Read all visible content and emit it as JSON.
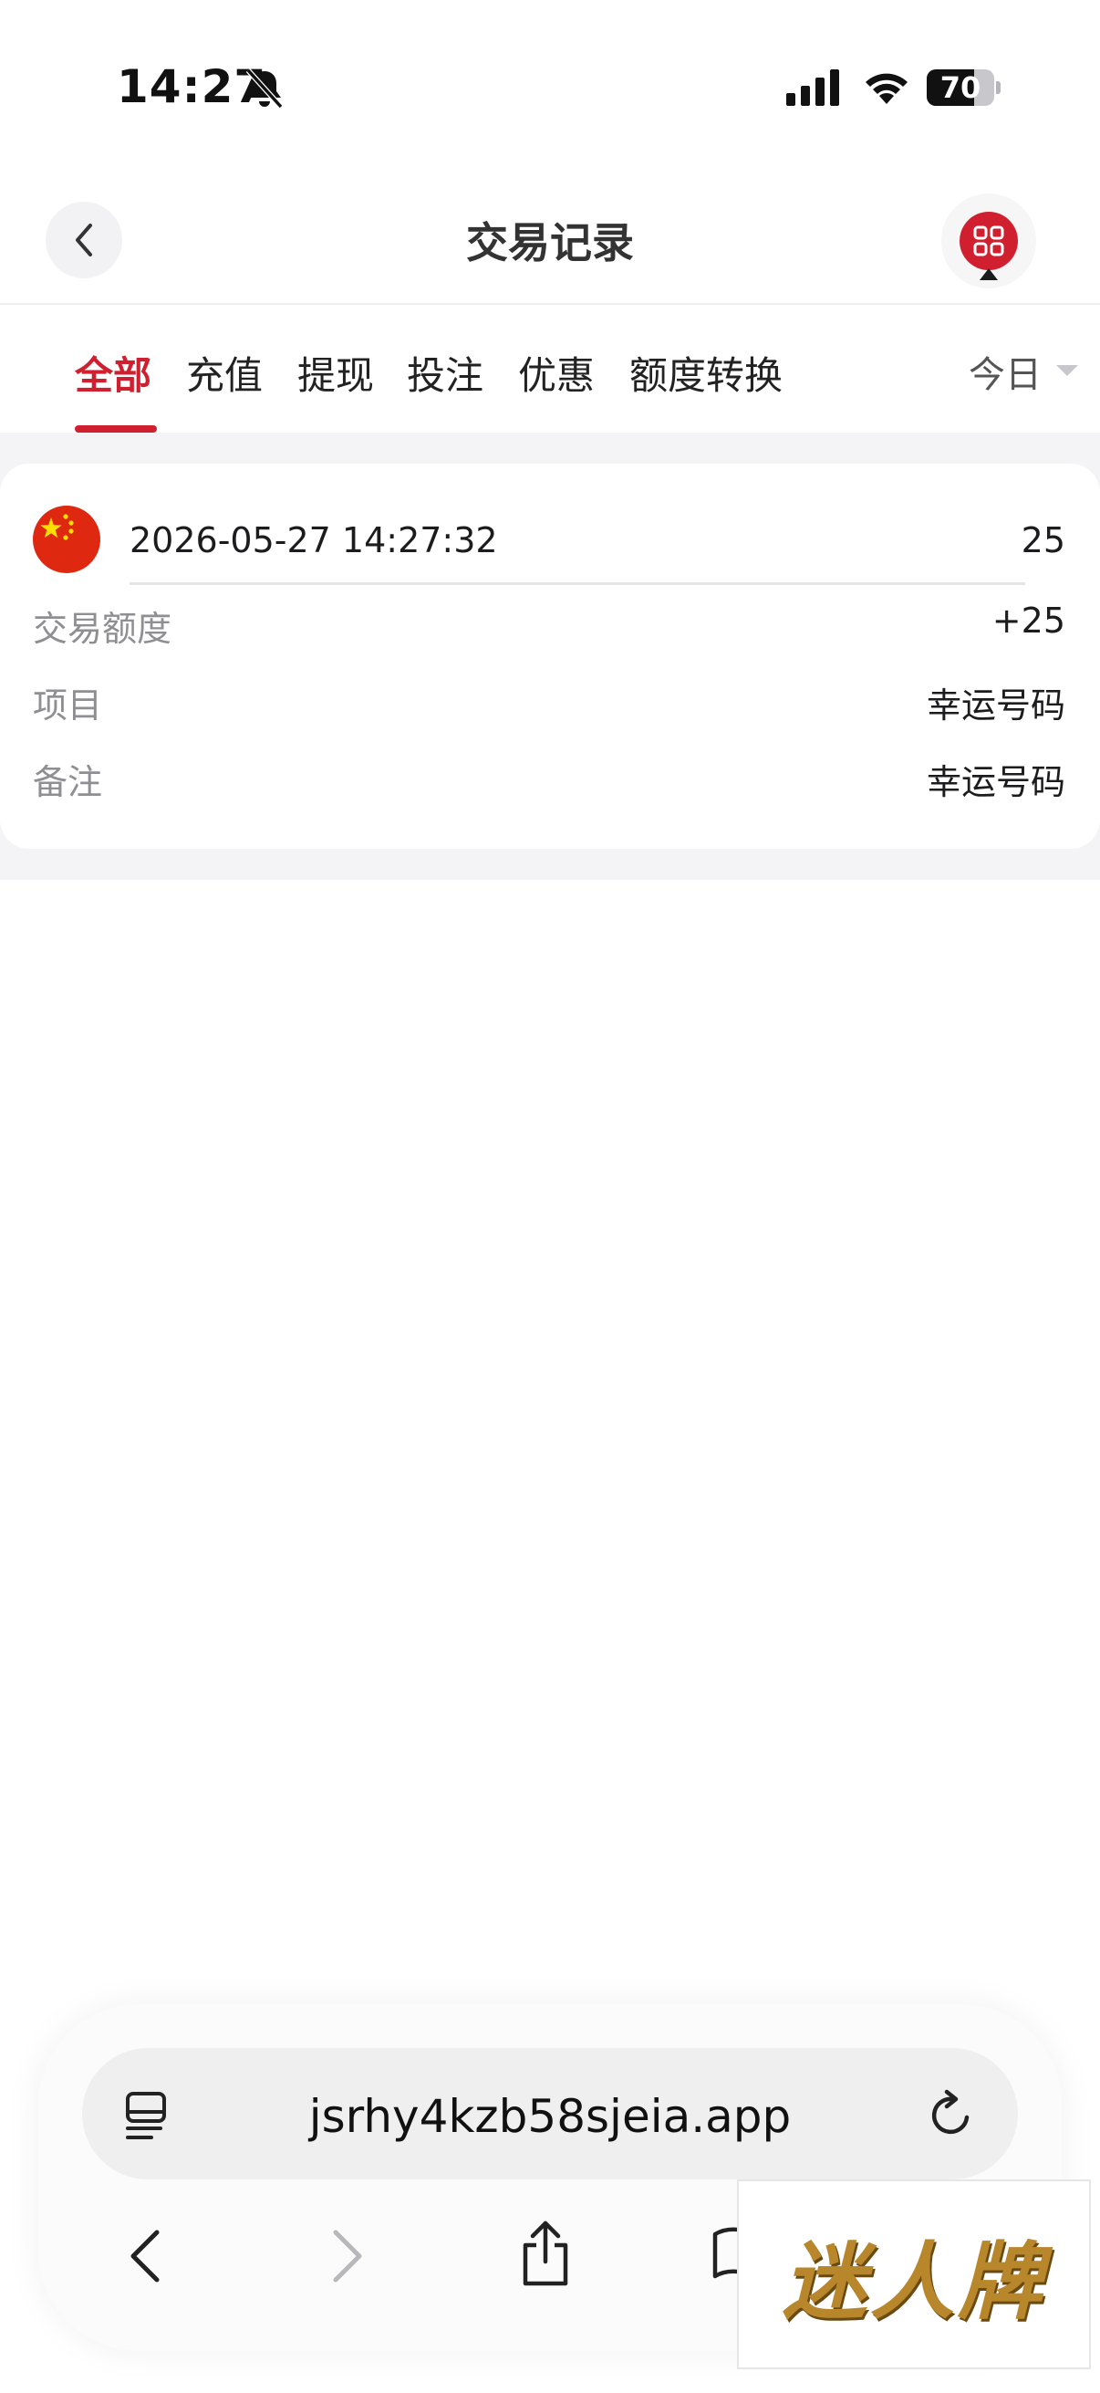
{
  "status_bar": {
    "time": "14:27",
    "battery_percent": "70",
    "battery_level": 0.7
  },
  "header": {
    "title": "交易记录"
  },
  "tabs": [
    {
      "label": "全部",
      "active": true
    },
    {
      "label": "充值",
      "active": false
    },
    {
      "label": "提现",
      "active": false
    },
    {
      "label": "投注",
      "active": false
    },
    {
      "label": "优惠",
      "active": false
    },
    {
      "label": "额度转换",
      "active": false
    }
  ],
  "date_filter": {
    "label": "今日"
  },
  "records": [
    {
      "time": "2026-05-27 14:27:32",
      "amount": "25",
      "rows": [
        {
          "label": "交易额度",
          "value": "+25"
        },
        {
          "label": "项目",
          "value": "幸运号码"
        },
        {
          "label": "备注",
          "value": "幸运号码"
        }
      ]
    }
  ],
  "browser": {
    "url": "jsrhy4kzb58sjeia.app"
  },
  "watermark": {
    "text": "迷人牌"
  },
  "colors": {
    "accent": "#d0202f",
    "label_gray": "#8e8e93",
    "background_gray": "#f4f4f6"
  }
}
